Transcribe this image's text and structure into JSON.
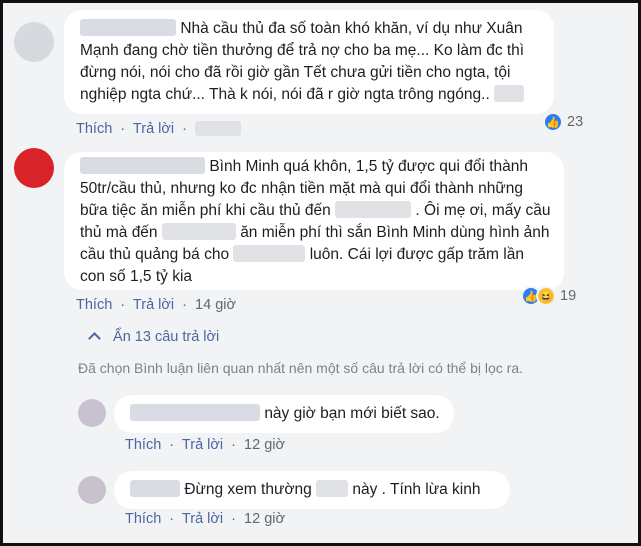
{
  "comments": [
    {
      "lines": [
        "Nhà cầu thủ đa số toàn khó khăn, ví dụ như Xuân",
        "Mạnh đang chờ tiền thưởng để trả nợ cho ba mẹ... Ko làm đc thì",
        "đừng nói, nói cho đã rồi giờ gần Tết chưa gửi tiền cho ngta, tội",
        "nghiệp ngta chứ... Thà k nói, nói đã r giờ ngta trông ngóng.."
      ],
      "like_label": "Thích",
      "reply_label": "Trả lời",
      "reaction_count": "23"
    },
    {
      "lines": [
        "Bình Minh quá khôn, 1,5 tỷ được qui đổi thành",
        "50tr/cầu thủ, nhưng ko đc nhận tiền mặt mà qui đổi thành những",
        "bữa tiệc ăn miễn phí khi cầu thủ đến",
        ". Ôi mẹ ơi, mấy cầu",
        "thủ mà đến",
        "ăn miễn phí thì sắn Bình Minh dùng hình ảnh",
        "cầu thủ quảng bá cho",
        "luôn. Cái lợi được gấp trăm lần",
        "con số 1,5 tỷ kia"
      ],
      "like_label": "Thích",
      "reply_label": "Trả lời",
      "time": "14 giờ",
      "reaction_count": "19"
    }
  ],
  "hide_replies": {
    "chevron": "^",
    "label": "Ẩn 13 câu trả lời"
  },
  "notice": "Đã chọn Bình luận liên quan nhất nên một số câu trả lời có thể bị lọc ra.",
  "replies": [
    {
      "text": "này giờ bạn mới biết sao.",
      "like_label": "Thích",
      "reply_label": "Trả lời",
      "time": "12 giờ"
    },
    {
      "text_before": "Đừng xem thường",
      "text_after": "này . Tính lừa kinh",
      "like_label": "Thích",
      "reply_label": "Trả lời",
      "time": "12 giờ"
    }
  ],
  "separator": "·",
  "icons": {
    "like": "like-icon",
    "haha": "haha-icon",
    "chevron": "chevron-up-icon"
  },
  "colors": {
    "link": "#4b67a1",
    "meta": "#606770",
    "background": "#f2f3f5",
    "like_reaction": "#2e7cf6",
    "haha_reaction": "#f7c23c"
  }
}
